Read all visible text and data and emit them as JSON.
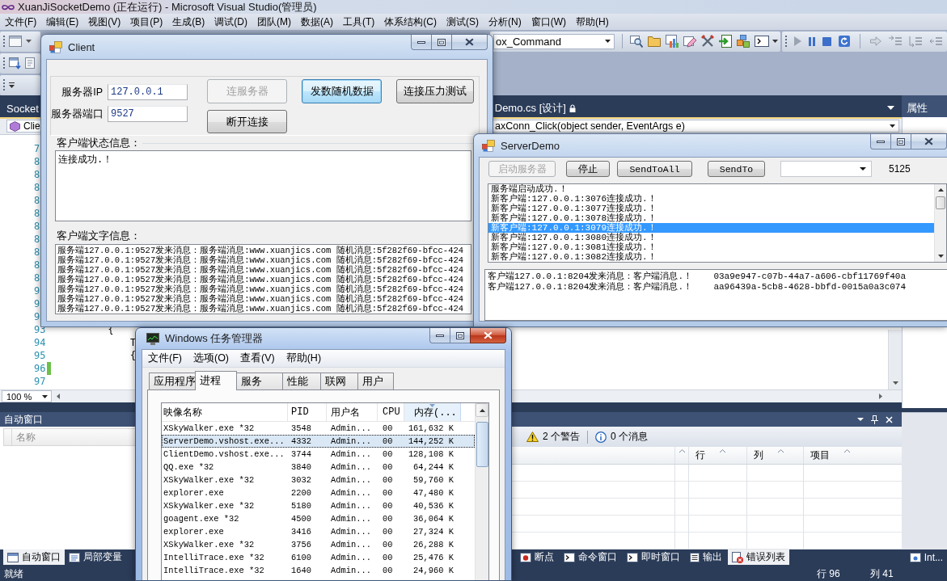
{
  "ide": {
    "title": "XuanJiSocketDemo (正在运行) - Microsoft Visual Studio(管理员)",
    "menu": [
      "文件(F)",
      "编辑(E)",
      "视图(V)",
      "项目(P)",
      "生成(B)",
      "调试(D)",
      "团队(M)",
      "数据(A)",
      "工具(T)",
      "体系结构(C)",
      "测试(S)",
      "分析(N)",
      "窗口(W)",
      "帮助(H)"
    ],
    "command_combo": "ox_Command",
    "document_tabs": [
      "Socket",
      "Demo.cs [设计]"
    ],
    "editor": {
      "type_dropdown": "Clie",
      "member_dropdown": "axConn_Click(object sender, EventArgs e)",
      "lines": [
        {
          "number": "7",
          "changed": false
        },
        {
          "number": "8",
          "changed": false
        },
        {
          "number": "8",
          "changed": false
        },
        {
          "number": "8",
          "changed": false
        },
        {
          "number": "8",
          "changed": false
        },
        {
          "number": "8",
          "changed": false
        },
        {
          "number": "8",
          "changed": false
        },
        {
          "number": "8",
          "changed": false
        },
        {
          "number": "8",
          "changed": false
        },
        {
          "number": "8",
          "changed": false
        },
        {
          "number": "8",
          "changed": false
        },
        {
          "number": "9",
          "changed": false
        },
        {
          "number": "9",
          "changed": false
        },
        {
          "number": "9",
          "changed": false
        },
        {
          "number": "93",
          "code": "        {",
          "changed": false
        },
        {
          "number": "94",
          "code": "            T",
          "changed": false
        },
        {
          "number": "95",
          "code": "            {",
          "changed": false
        },
        {
          "number": "96",
          "changed": true
        },
        {
          "number": "97",
          "changed": false
        }
      ],
      "zoom": "100 %"
    },
    "properties": {
      "title": "属性",
      "tab": "Int..."
    },
    "auto_window": {
      "title": "自动窗口",
      "columns": [
        "名称"
      ],
      "tabs": [
        {
          "label": "自动窗口",
          "selected": true
        },
        {
          "label": "局部变量",
          "selected": false
        }
      ]
    },
    "error_list": {
      "warnings": "2 个警告",
      "messages": "0 个消息",
      "columns": [
        "行",
        "列",
        "项目"
      ],
      "tabs": [
        {
          "label": "断点",
          "selected": false
        },
        {
          "label": "命令窗口",
          "selected": false
        },
        {
          "label": "即时窗口",
          "selected": false
        },
        {
          "label": "输出",
          "selected": false
        },
        {
          "label": "错误列表",
          "selected": true
        }
      ]
    },
    "status_bar": {
      "text": "就绪",
      "line": "行 96",
      "column": "列 41"
    }
  },
  "client": {
    "title": "Client",
    "active": false,
    "fields": [
      {
        "label": "服务器IP",
        "value": "127.0.0.1"
      },
      {
        "label": "服务器端口",
        "value": "9527"
      }
    ],
    "buttons": [
      {
        "label": "连服务器",
        "disabled": true,
        "focused": false
      },
      {
        "label": "发数随机数据",
        "disabled": false,
        "focused": true
      },
      {
        "label": "连接压力测试",
        "disabled": false,
        "focused": false
      },
      {
        "label": "断开连接",
        "disabled": false,
        "focused": false
      }
    ],
    "status_label": "客户端状态信息：",
    "status_text": "连接成功.！",
    "messages_label": "客户端文字信息：",
    "messages": [
      "服务端127.0.0.1:9527发来消息：服务端消息:www.xuanjics.com 随机消息:5f282f69-bfcc-424",
      "服务端127.0.0.1:9527发来消息：服务端消息:www.xuanjics.com 随机消息:5f282f69-bfcc-424",
      "服务端127.0.0.1:9527发来消息：服务端消息:www.xuanjics.com 随机消息:5f282f69-bfcc-424",
      "服务端127.0.0.1:9527发来消息：服务端消息:www.xuanjics.com 随机消息:5f282f69-bfcc-424",
      "服务端127.0.0.1:9527发来消息：服务端消息:www.xuanjics.com 随机消息:5f282f69-bfcc-424",
      "服务端127.0.0.1:9527发来消息：服务端消息:www.xuanjics.com 随机消息:5f282f69-bfcc-424",
      "服务端127.0.0.1:9527发来消息：服务端消息:www.xuanjics.com 随机消息:5f282f69-bfcc-424"
    ]
  },
  "server": {
    "title": "ServerDemo",
    "active": false,
    "buttons": [
      {
        "label": "启动服务器",
        "disabled": true
      },
      {
        "label": "停止",
        "disabled": false
      },
      {
        "label": "SendToAll",
        "disabled": false
      },
      {
        "label": "SendTo",
        "disabled": false
      }
    ],
    "port": "5125",
    "log": [
      {
        "text": "服务端启动成功.！",
        "selected": false
      },
      {
        "text": "新客户端:127.0.0.1:3076连接成功.！",
        "selected": false
      },
      {
        "text": "新客户端:127.0.0.1:3077连接成功.！",
        "selected": false
      },
      {
        "text": "新客户端:127.0.0.1:3078连接成功.！",
        "selected": false
      },
      {
        "text": "新客户端:127.0.0.1:3079连接成功.！",
        "selected": true
      },
      {
        "text": "新客户端:127.0.0.1:3080连接成功.！",
        "selected": false
      },
      {
        "text": "新客户端:127.0.0.1:3081连接成功.！",
        "selected": false
      },
      {
        "text": "新客户端:127.0.0.1:3082连接成功.！",
        "selected": false
      }
    ],
    "messages": [
      "客户端127.0.0.1:8204发来消息：客户端消息.！    03a9e947-c07b-44a7-a606-cbf11769f40a",
      "客户端127.0.0.1:8204发来消息：客户端消息.！    aa96439a-5cb8-4628-bbfd-0015a0a3c074"
    ]
  },
  "task_manager": {
    "title": "Windows 任务管理器",
    "active": true,
    "menu": [
      "文件(F)",
      "选项(O)",
      "查看(V)",
      "帮助(H)"
    ],
    "tabs": [
      {
        "label": "应用程序",
        "selected": false
      },
      {
        "label": "进程",
        "selected": true
      },
      {
        "label": "服务",
        "selected": false
      },
      {
        "label": "性能",
        "selected": false
      },
      {
        "label": "联网",
        "selected": false
      },
      {
        "label": "用户",
        "selected": false
      }
    ],
    "columns": [
      {
        "label": "映像名称",
        "sorted": false
      },
      {
        "label": "PID",
        "sorted": false
      },
      {
        "label": "用户名",
        "sorted": false
      },
      {
        "label": "CPU",
        "sorted": false
      },
      {
        "label": "内存(...",
        "sorted": true
      }
    ],
    "processes": [
      {
        "name": "XSkyWalker.exe *32",
        "pid": "3548",
        "user": "Admin...",
        "cpu": "00",
        "memory": "161,632 K",
        "selected": false
      },
      {
        "name": "ServerDemo.vshost.exe...",
        "pid": "4332",
        "user": "Admin...",
        "cpu": "00",
        "memory": "144,252 K",
        "selected": true
      },
      {
        "name": "ClientDemo.vshost.exe...",
        "pid": "3744",
        "user": "Admin...",
        "cpu": "00",
        "memory": "128,108 K",
        "selected": false
      },
      {
        "name": "QQ.exe *32",
        "pid": "3840",
        "user": "Admin...",
        "cpu": "00",
        "memory": "64,244 K",
        "selected": false
      },
      {
        "name": "XSkyWalker.exe *32",
        "pid": "3032",
        "user": "Admin...",
        "cpu": "00",
        "memory": "59,760 K",
        "selected": false
      },
      {
        "name": "explorer.exe",
        "pid": "2200",
        "user": "Admin...",
        "cpu": "00",
        "memory": "47,480 K",
        "selected": false
      },
      {
        "name": "XSkyWalker.exe *32",
        "pid": "5180",
        "user": "Admin...",
        "cpu": "00",
        "memory": "40,536 K",
        "selected": false
      },
      {
        "name": "goagent.exe *32",
        "pid": "4500",
        "user": "Admin...",
        "cpu": "00",
        "memory": "36,064 K",
        "selected": false
      },
      {
        "name": "explorer.exe",
        "pid": "3416",
        "user": "Admin...",
        "cpu": "00",
        "memory": "27,324 K",
        "selected": false
      },
      {
        "name": "XSkyWalker.exe *32",
        "pid": "3756",
        "user": "Admin...",
        "cpu": "00",
        "memory": "26,288 K",
        "selected": false
      },
      {
        "name": "IntelliTrace.exe *32",
        "pid": "6100",
        "user": "Admin...",
        "cpu": "00",
        "memory": "25,476 K",
        "selected": false
      },
      {
        "name": "IntelliTrace.exe *32",
        "pid": "1640",
        "user": "Admin...",
        "cpu": "00",
        "memory": "24,960 K",
        "selected": false
      }
    ]
  }
}
